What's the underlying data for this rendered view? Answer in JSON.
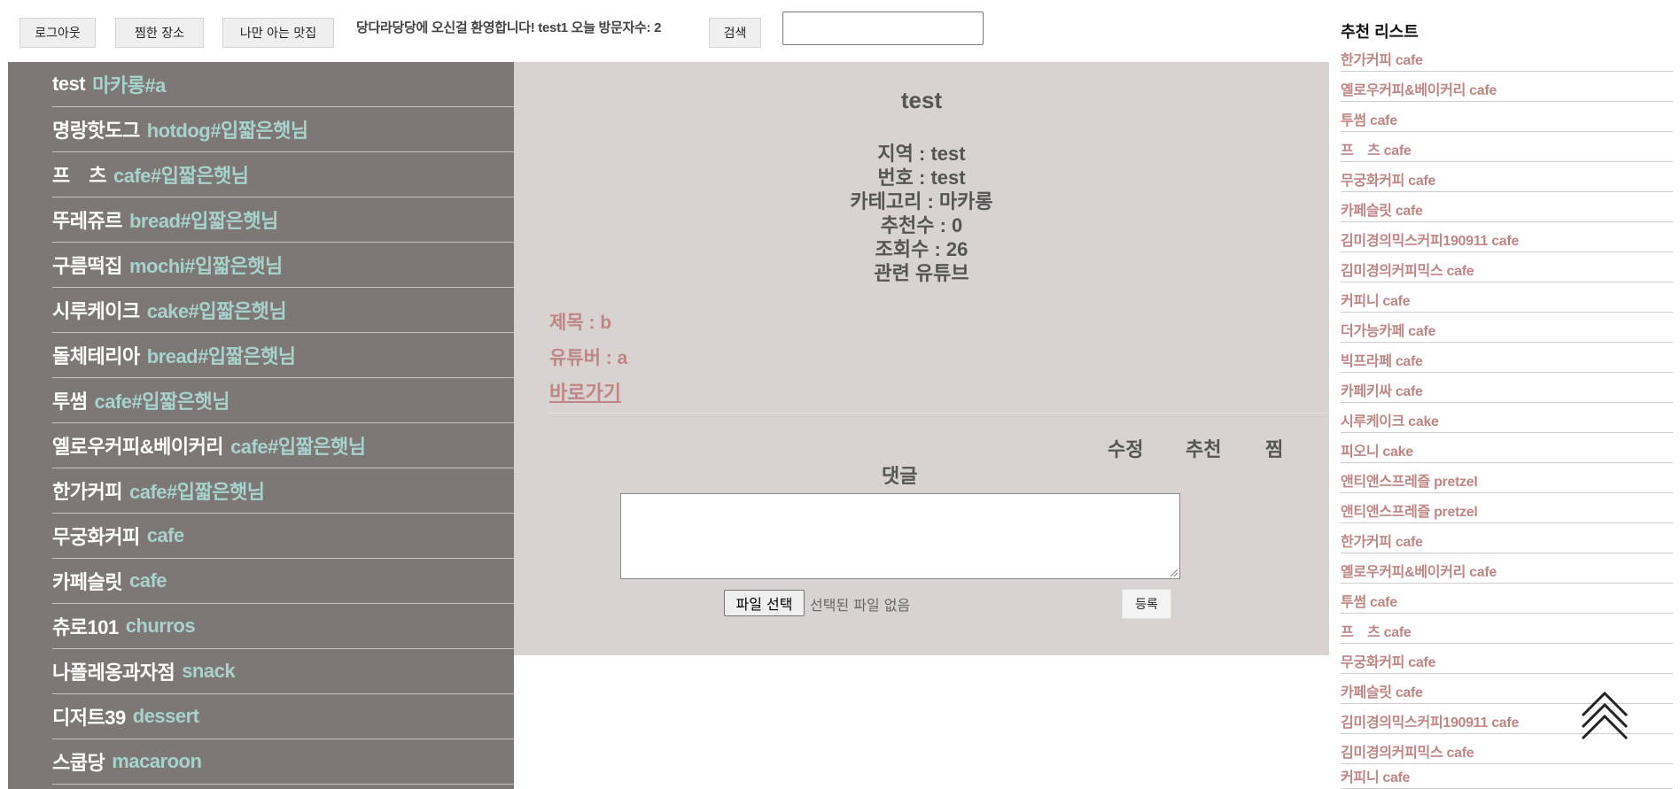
{
  "header": {
    "logout_label": "로그아웃",
    "saved_places_label": "찜한 장소",
    "my_places_label": "나만 아는 맛집",
    "welcome_text": "당다라당당에 오신걸 환영합니다! test1 오늘 방문자수: 2",
    "search_label": "검색",
    "search_value": ""
  },
  "left_list": [
    {
      "name": "test",
      "tag": "마카롱#a"
    },
    {
      "name": "명랑핫도그",
      "tag": "hotdog#입짧은햇님"
    },
    {
      "name": "프　츠",
      "tag": "cafe#입짧은햇님"
    },
    {
      "name": "뚜레쥬르",
      "tag": "bread#입짧은햇님"
    },
    {
      "name": "구름떡집",
      "tag": "mochi#입짧은햇님"
    },
    {
      "name": "시루케이크",
      "tag": "cake#입짧은햇님"
    },
    {
      "name": "돌체테리아",
      "tag": "bread#입짧은햇님"
    },
    {
      "name": "투썸",
      "tag": "cafe#입짧은햇님"
    },
    {
      "name": "옐로우커피&베이커리",
      "tag": "cafe#입짧은햇님"
    },
    {
      "name": "한가커피",
      "tag": "cafe#입짧은햇님"
    },
    {
      "name": "무궁화커피",
      "tag": "cafe"
    },
    {
      "name": "카페슬릿",
      "tag": "cafe"
    },
    {
      "name": "츄로101",
      "tag": "churros"
    },
    {
      "name": "나폴레옹과자점",
      "tag": "snack"
    },
    {
      "name": "디저트39",
      "tag": "dessert"
    },
    {
      "name": "스쿱당",
      "tag": "macaroon"
    }
  ],
  "detail": {
    "title": "test",
    "region": "지역 : test",
    "number": "번호 : test",
    "category": "카테고리 : 마카롱",
    "recommend_count": "추천수 : 0",
    "view_count": "조회수 : 26",
    "related_youtube": "관련 유튜브",
    "youtube_title": "제목 : b",
    "youtube_creator": "유튜버 : a",
    "youtube_link": "바로가기",
    "edit_label": "수정",
    "recommend_label": "추천",
    "save_label": "찜",
    "comment_label": "댓글",
    "comment_value": "",
    "file_button_label": "파일 선택",
    "file_status": "선택된 파일 없음",
    "submit_label": "등록"
  },
  "recommend_list": {
    "title": "추천 리스트",
    "items": [
      "한가커피 cafe",
      "옐로우커피&베이커리 cafe",
      "투썸 cafe",
      "프　츠 cafe",
      "무궁화커피 cafe",
      "카페슬릿 cafe",
      "김미경의믹스커피190911 cafe",
      "김미경의커피믹스 cafe",
      "커피니 cafe",
      "더가능카페 cafe",
      "빅프라페 cafe",
      "카페키싸 cafe",
      "시루케이크 cake",
      "피오니 cake",
      "앤티앤스프레즐 pretzel",
      "앤티앤스프레즐 pretzel",
      "한가커피 cafe",
      "옐로우커피&베이커리 cafe",
      "투썸 cafe",
      "프　츠 cafe",
      "무궁화커피 cafe",
      "카페슬릿 cafe",
      "김미경의믹스커피190911 cafe",
      "김미경의커피믹스 cafe",
      "커피니 cafe"
    ]
  },
  "icons": {
    "scroll_top": "double-chevron-up-icon"
  },
  "colors": {
    "left_panel_bg": "#7d7775",
    "left_tag": "#a8d2cc",
    "center_bg": "#d8d3d0",
    "accent_rose": "#c08686"
  }
}
